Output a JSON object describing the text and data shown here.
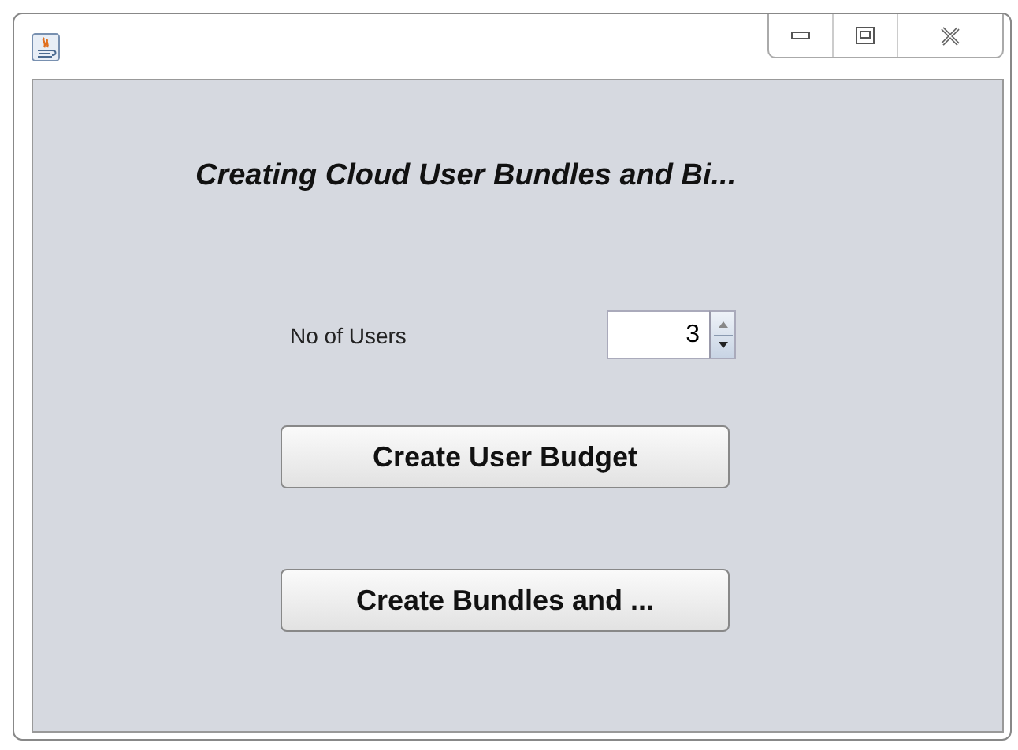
{
  "window": {
    "controls": [
      {
        "kind": "minimize"
      },
      {
        "kind": "maximize"
      },
      {
        "kind": "close"
      }
    ]
  },
  "heading": "Creating Cloud User Bundles and Bi...",
  "users_field": {
    "label": "No of Users",
    "value": "3"
  },
  "buttons": [
    "Create User Budget",
    "Create Bundles and ..."
  ]
}
